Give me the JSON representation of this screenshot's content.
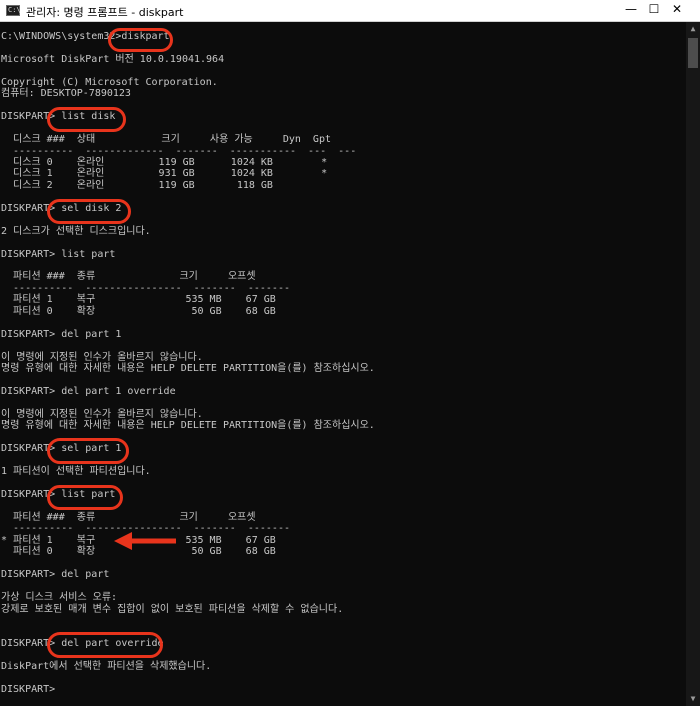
{
  "window": {
    "title": "관리자: 명령 프롬프트 - diskpart",
    "icon_label": "C:\\",
    "controls": {
      "minimize": "—",
      "maximize": "☐",
      "close": "✕"
    }
  },
  "console": {
    "lines": [
      "C:\\WINDOWS\\system32>diskpart",
      "",
      "Microsoft DiskPart 버전 10.0.19041.964",
      "",
      "Copyright (C) Microsoft Corporation.",
      "컴퓨터: DESKTOP-7890123",
      "",
      "DISKPART> list disk",
      "",
      "  디스크 ###  상태           크기     사용 가능     Dyn  Gpt",
      "  ----------  -------------  -------  -----------  ---  ---",
      "  디스크 0    온라인         119 GB      1024 KB        *",
      "  디스크 1    온라인         931 GB      1024 KB        *",
      "  디스크 2    온라인         119 GB       118 GB",
      "",
      "DISKPART> sel disk 2",
      "",
      "2 디스크가 선택한 디스크입니다.",
      "",
      "DISKPART> list part",
      "",
      "  파티션 ###  종류              크기     오프셋",
      "  ----------  ----------------  -------  -------",
      "  파티션 1    복구               535 MB    67 GB",
      "  파티션 0    확장                50 GB    68 GB",
      "",
      "DISKPART> del part 1",
      "",
      "이 명령에 지정된 인수가 올바르지 않습니다.",
      "명령 유형에 대한 자세한 내용은 HELP DELETE PARTITION을(를) 참조하십시오.",
      "",
      "DISKPART> del part 1 override",
      "",
      "이 명령에 지정된 인수가 올바르지 않습니다.",
      "명령 유형에 대한 자세한 내용은 HELP DELETE PARTITION을(를) 참조하십시오.",
      "",
      "DISKPART> sel part 1",
      "",
      "1 파티션이 선택한 파티션입니다.",
      "",
      "DISKPART> list part",
      "",
      "  파티션 ###  종류              크기     오프셋",
      "  ----------  ----------------  -------  -------",
      "* 파티션 1    복구               535 MB    67 GB",
      "  파티션 0    확장                50 GB    68 GB",
      "",
      "DISKPART> del part",
      "",
      "가상 디스크 서비스 오류:",
      "강제로 보호된 매개 변수 집합이 없이 보호된 파티션을 삭제할 수 없습니다.",
      "",
      "",
      "DISKPART> del part override",
      "",
      "DiskPart에서 선택한 파티션을 삭제했습니다.",
      "",
      "DISKPART>"
    ]
  },
  "colors": {
    "console_bg": "#0c0c0c",
    "console_text": "#c8c8c8",
    "highlight": "#e8341c"
  }
}
